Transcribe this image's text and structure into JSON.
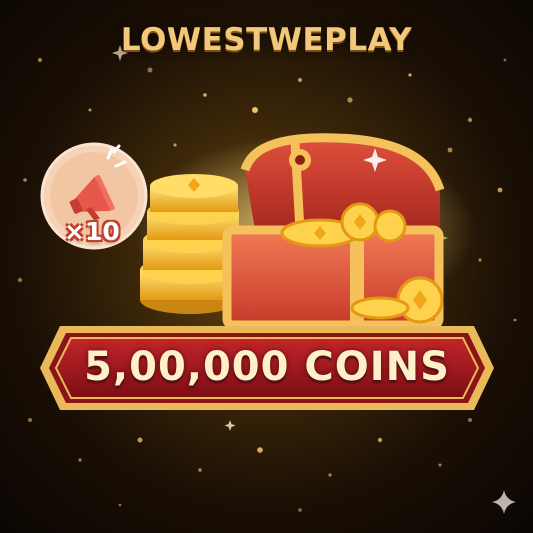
{
  "title": "LOWESTWEPLAY",
  "badge": {
    "icon": "megaphone-icon",
    "count_label": "×10"
  },
  "reward": {
    "icon": "treasure-chest-icon",
    "amount_label": "5,00,000 COINS"
  },
  "corner_icon": "sparkle-star-icon",
  "colors": {
    "title_gold": "#f3c87a",
    "banner_red": "#a0161c",
    "banner_gold": "#e9b95a",
    "coin_gold": "#f5b623",
    "chest_red": "#e0553a",
    "badge_peach": "#f6d3b6"
  }
}
